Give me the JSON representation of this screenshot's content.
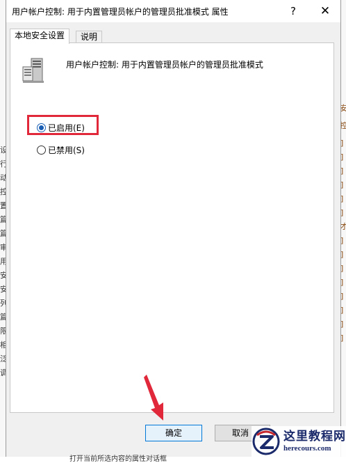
{
  "dialog": {
    "title": "用户帐户控制: 用于内置管理员帐户的管理员批准模式 属性",
    "help": "?",
    "close": "✕"
  },
  "tabs": [
    {
      "label": "本地安全设置",
      "active": true
    },
    {
      "label": "说明",
      "active": false
    }
  ],
  "policy": {
    "icon": "server-policy-icon",
    "name": "用户帐户控制: 用于内置管理员帐户的管理员批准模式"
  },
  "options": {
    "enabled": {
      "label": "已启用(E)",
      "checked": true
    },
    "disabled": {
      "label": "已禁用(S)",
      "checked": false
    }
  },
  "buttons": {
    "ok": "确定",
    "cancel": "取消"
  },
  "watermark": {
    "title": "这里教程网",
    "url": "herecours.com"
  },
  "background": {
    "left_chars": [
      "设",
      "行",
      "动",
      "控",
      "置",
      "篇",
      "篇",
      "审",
      "用",
      "安",
      "安",
      "列",
      "篇",
      "限",
      "相",
      "泛",
      "调"
    ],
    "right_chars": [
      "安",
      "控",
      "]",
      "]",
      "]",
      "]",
      "]",
      "]",
      "才",
      "]",
      "]",
      "]",
      "]",
      "]",
      "]",
      "]",
      "]"
    ],
    "bottom_text": "打开当前所选内容的属性对话框"
  },
  "colors": {
    "highlight": "#e0283a",
    "arrow": "#e0283a",
    "accent": "#0078d7"
  }
}
